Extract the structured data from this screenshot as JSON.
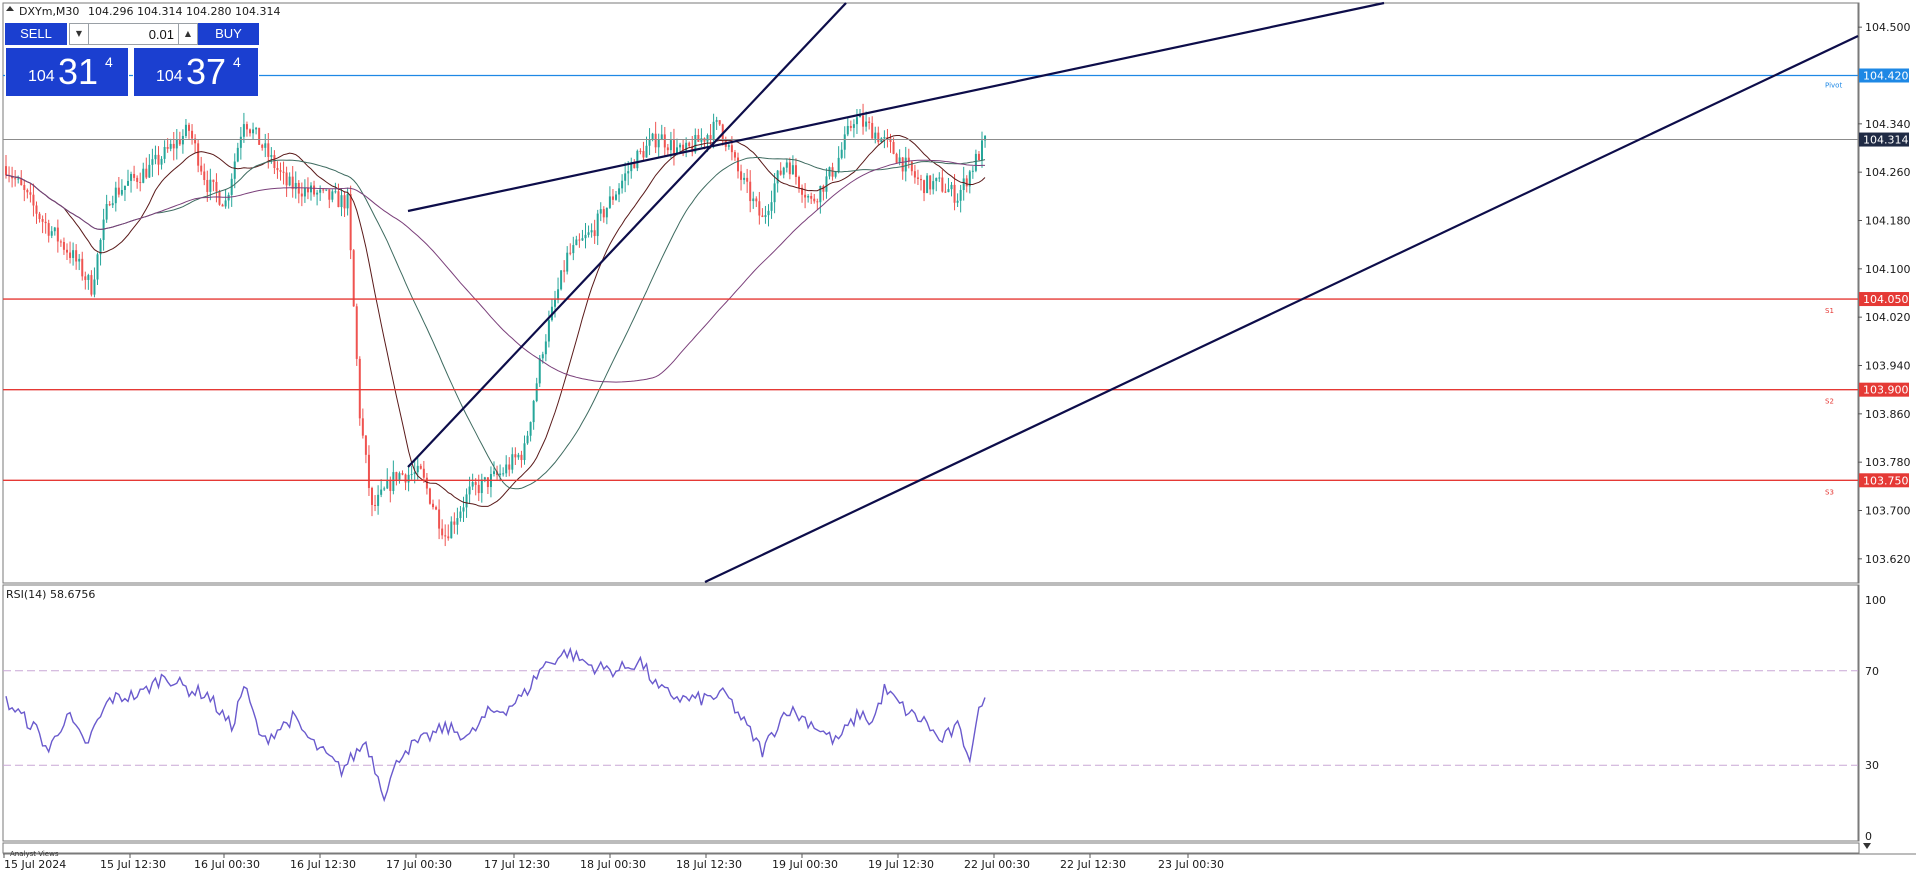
{
  "header": {
    "symbol": "DXYm,M30",
    "ohlc": "104.296 104.314 104.280 104.314"
  },
  "trade_panel": {
    "sell_label": "SELL",
    "buy_label": "BUY",
    "lot": "0.01",
    "sell_price": {
      "small": "104",
      "big": "31",
      "sup": "4"
    },
    "buy_price": {
      "small": "104",
      "big": "37",
      "sup": "4"
    }
  },
  "colors": {
    "bull": "#26a69a",
    "bear": "#ef5350",
    "pivot": "#1e88e5",
    "support": "#e53935",
    "channel": "#0d0d4a",
    "rsi": "#6a5acd"
  },
  "chart_data": [
    {
      "type": "candlestick",
      "timeframe": "M30",
      "ylim": [
        103.58,
        104.54
      ],
      "y_ticks": [
        "104.500",
        "104.340",
        "104.260",
        "104.180",
        "104.100",
        "104.020",
        "103.940",
        "103.860",
        "103.780",
        "103.700",
        "103.620"
      ],
      "x_ticks": [
        "15 Jul 2024",
        "15 Jul 12:30",
        "16 Jul 00:30",
        "16 Jul 12:30",
        "17 Jul 00:30",
        "17 Jul 12:30",
        "18 Jul 00:30",
        "18 Jul 12:30",
        "19 Jul 00:30",
        "19 Jul 12:30",
        "22 Jul 00:30",
        "22 Jul 12:30",
        "23 Jul 00:30"
      ],
      "current_price": "104.314",
      "levels": [
        {
          "name": "Pivot",
          "value": "104.420"
        },
        {
          "name": "S1",
          "value": "104.050"
        },
        {
          "name": "S2",
          "value": "103.900"
        },
        {
          "name": "S3",
          "value": "103.750"
        }
      ],
      "trend_channel": "ascending",
      "moving_averages": 3
    },
    {
      "type": "line",
      "title": "RSI(14) 58.6756",
      "ylim": [
        0,
        100
      ],
      "y_ticks": [
        "100",
        "70",
        "30",
        "0"
      ],
      "levels": [
        70,
        30
      ],
      "last_value": 58.6756
    }
  ],
  "footer": {
    "panel_label": "Analyst Views"
  }
}
